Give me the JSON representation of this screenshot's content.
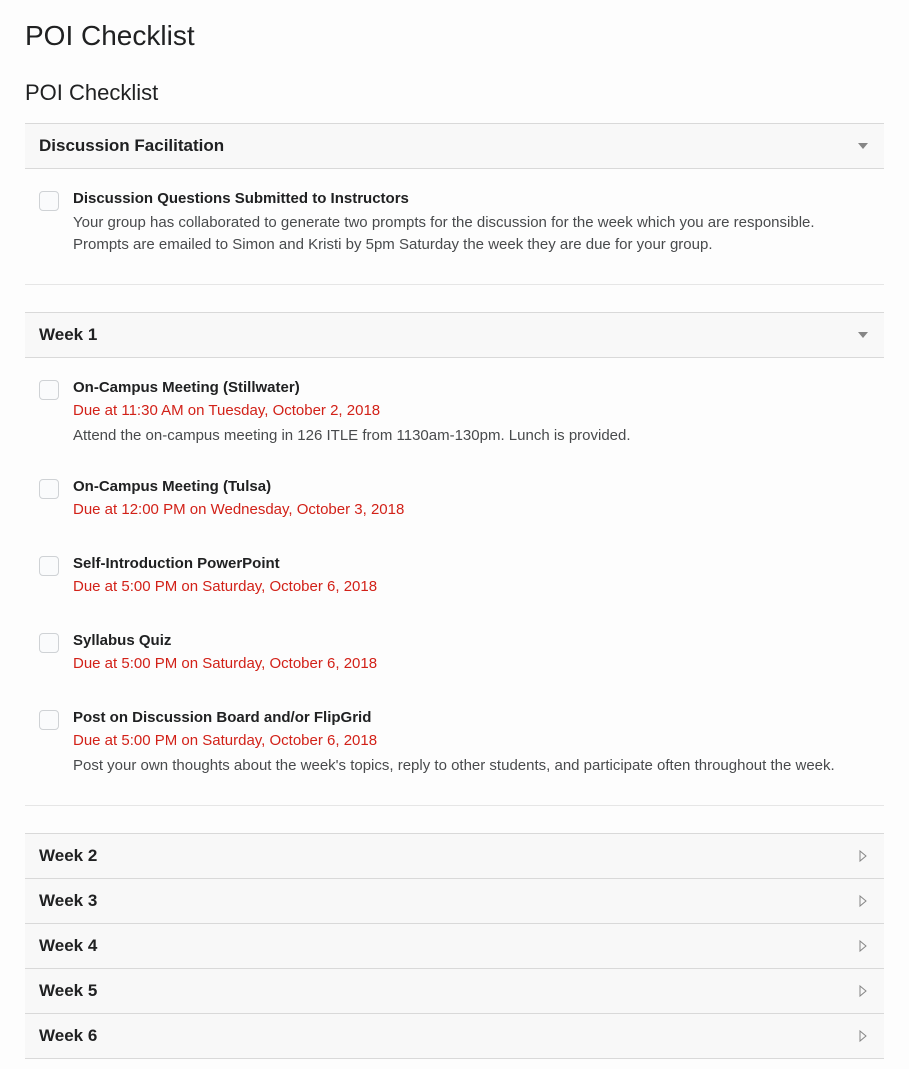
{
  "page": {
    "title": "POI Checklist",
    "checklist_title": "POI Checklist"
  },
  "sections": [
    {
      "title": "Discussion Facilitation",
      "expanded": true,
      "items": [
        {
          "title": "Discussion Questions Submitted to Instructors",
          "due": "",
          "desc": "Your group has collaborated to generate two prompts for the discussion for the week which you are responsible. Prompts are emailed to Simon and Kristi by 5pm Saturday the week they are due for your group."
        }
      ]
    },
    {
      "title": "Week 1",
      "expanded": true,
      "items": [
        {
          "title": "On-Campus Meeting (Stillwater)",
          "due": "Due at 11:30 AM on Tuesday, October 2, 2018",
          "desc": "Attend the on-campus meeting in 126 ITLE from 1130am-130pm. Lunch is provided."
        },
        {
          "title": "On-Campus Meeting (Tulsa)",
          "due": "Due at 12:00 PM on Wednesday, October 3, 2018",
          "desc": ""
        },
        {
          "title": "Self-Introduction PowerPoint",
          "due": "Due at 5:00 PM on Saturday, October 6, 2018",
          "desc": ""
        },
        {
          "title": "Syllabus Quiz",
          "due": "Due at 5:00 PM on Saturday, October 6, 2018",
          "desc": ""
        },
        {
          "title": "Post on Discussion Board and/or FlipGrid",
          "due": "Due at 5:00 PM on Saturday, October 6, 2018",
          "desc": "Post your own thoughts about the week's topics, reply to other students, and participate often throughout the week."
        }
      ]
    },
    {
      "title": "Week 2",
      "expanded": false,
      "items": []
    },
    {
      "title": "Week 3",
      "expanded": false,
      "items": []
    },
    {
      "title": "Week 4",
      "expanded": false,
      "items": []
    },
    {
      "title": "Week 5",
      "expanded": false,
      "items": []
    },
    {
      "title": "Week 6",
      "expanded": false,
      "items": []
    }
  ]
}
